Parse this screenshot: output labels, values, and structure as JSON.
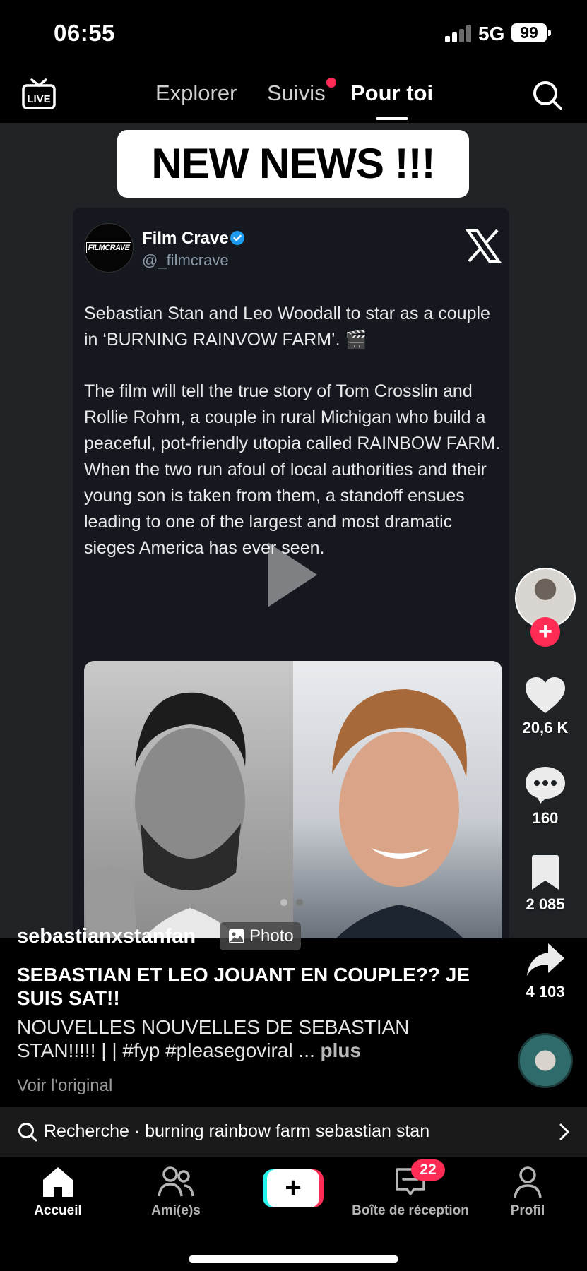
{
  "status_bar": {
    "time": "06:55",
    "network": "5G",
    "battery": "99"
  },
  "top_nav": {
    "live_label": "LIVE",
    "tabs": [
      {
        "label": "Explorer"
      },
      {
        "label": "Suivis"
      },
      {
        "label": "Pour toi"
      }
    ]
  },
  "video": {
    "banner": "NEW NEWS !!!",
    "tweet": {
      "avatar_text": "FILMCRAVE",
      "name": "Film Crave",
      "handle": "@_filmcrave",
      "paragraph_1": "Sebastian Stan and Leo Woodall to star as a couple in ‘BURNING RAINVOW FARM’. 🎬",
      "paragraph_2": "The film will tell the true story of Tom Crosslin and Rollie Rohm, a couple in rural Michigan who build a peaceful, pot-friendly utopia called RAINBOW FARM. When the two run afoul of local authorities and their young son is taken from them, a standoff ensues leading to one of the largest and most dramatic sieges America has ever seen."
    }
  },
  "actions": {
    "likes": "20,6 K",
    "comments": "160",
    "saves": "2 085",
    "shares": "4 103"
  },
  "caption": {
    "username": "sebastianxstanfan",
    "photo_badge": "Photo",
    "title": "SEBASTIAN ET LEO JOUANT EN COUPLE?? JE SUIS SAT!!",
    "description": "NOUVELLES NOUVELLES DE SEBASTIAN STAN!!!!! | | #fyp #pleasegoviral ...",
    "more": "plus",
    "see_original": "Voir l'original"
  },
  "search_bar": {
    "text": "Recherche · burning rainbow farm sebastian stan"
  },
  "bottom_nav": {
    "home": "Accueil",
    "friends": "Ami(e)s",
    "inbox": "Boîte de réception",
    "inbox_badge": "22",
    "profile": "Profil"
  },
  "colors": {
    "accent": "#fe2c55",
    "cyan": "#25f4ee",
    "verified": "#1d9bf0"
  }
}
